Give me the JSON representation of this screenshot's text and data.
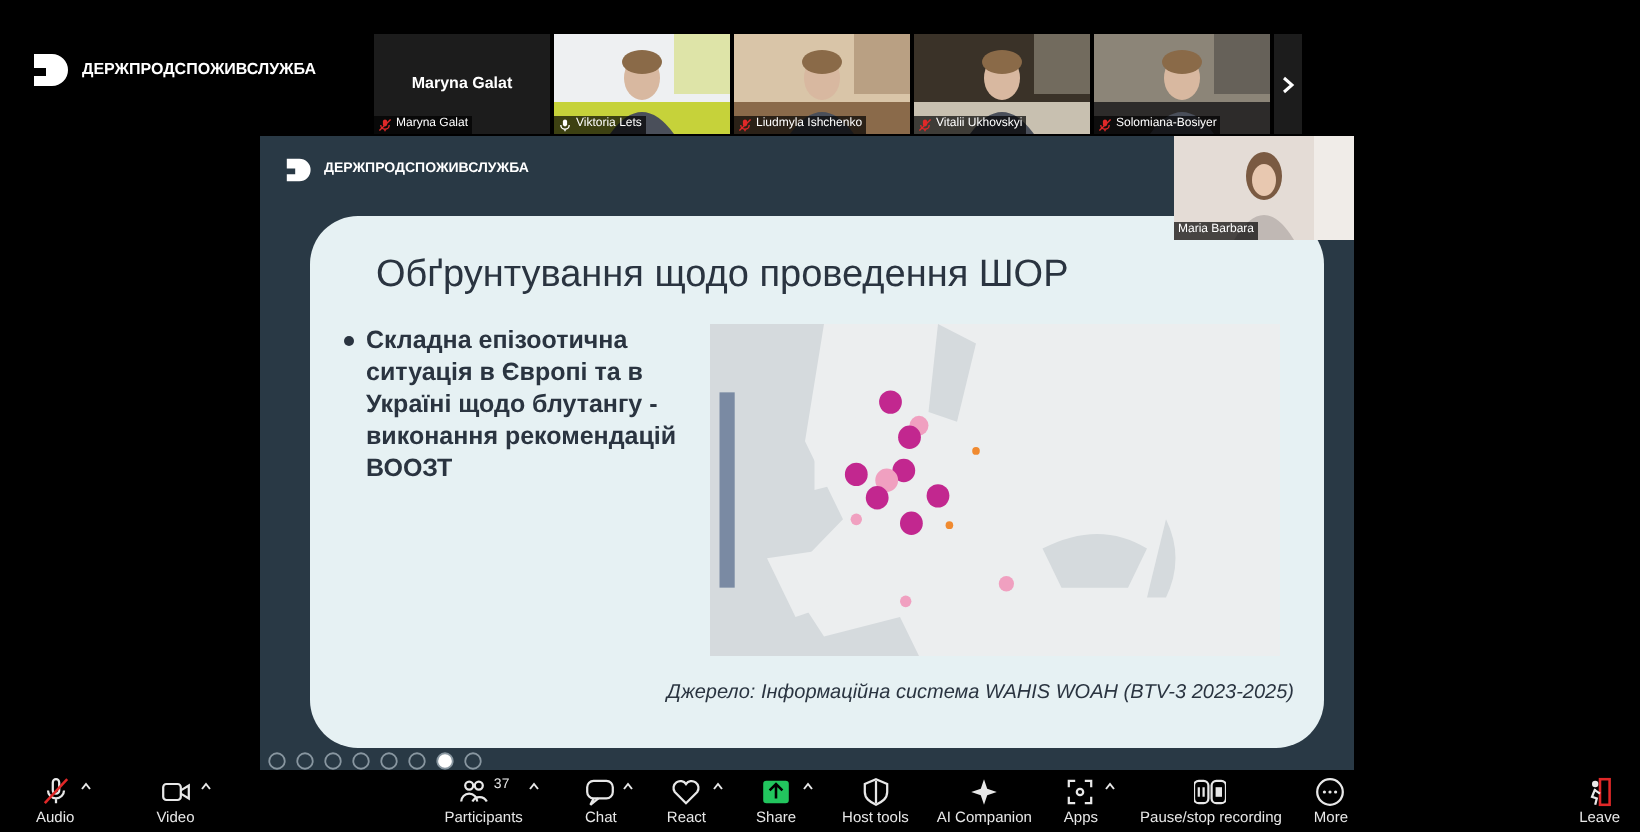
{
  "header": {
    "logo_text": "ДЕРЖПРОДСПОЖИВСЛУЖБА"
  },
  "participants_strip": [
    {
      "name": "Maryna Galat",
      "muted": true,
      "kind": "name_only",
      "title": "Maryna Galat"
    },
    {
      "name": "Viktoria Lets",
      "muted": false,
      "kind": "picture"
    },
    {
      "name": "Liudmyla Ishchenko",
      "muted": true,
      "kind": "picture"
    },
    {
      "name": "Vitalii Ukhovskyi",
      "muted": true,
      "kind": "picture"
    },
    {
      "name": "Solomiana-Bosiyer",
      "muted": true,
      "kind": "picture"
    }
  ],
  "presenter": {
    "name": "Maria Barbara"
  },
  "slide": {
    "logo_text": "ДЕРЖПРОДСПОЖИВСЛУЖБА",
    "title": "Обґрунтування щодо проведення ШОР",
    "bullet": "Складна епізоотична ситуація в Європі та в Україні щодо блутангу - виконання рекомендацій ВООЗТ",
    "source": "Джерело: Інформаційна система WAHIS WOAH (BTV-3 2023-2025)"
  },
  "toolbar": [
    {
      "label": "Audio",
      "kind": "mic",
      "caret": true,
      "muted": true
    },
    {
      "label": "Video",
      "kind": "video",
      "caret": true
    },
    {
      "label": "Participants",
      "kind": "people",
      "caret": true,
      "count": "37"
    },
    {
      "label": "Chat",
      "kind": "chat",
      "caret": true
    },
    {
      "label": "React",
      "kind": "heart",
      "caret": true
    },
    {
      "label": "Share",
      "kind": "share",
      "caret": true
    },
    {
      "label": "Host tools",
      "kind": "shield",
      "caret": false
    },
    {
      "label": "AI Companion",
      "kind": "sparkle",
      "caret": false
    },
    {
      "label": "Apps",
      "kind": "apps",
      "caret": true
    },
    {
      "label": "Pause/stop recording",
      "kind": "record",
      "caret": false
    },
    {
      "label": "More",
      "kind": "more",
      "caret": false
    },
    {
      "label": "Leave",
      "kind": "leave",
      "caret": false
    }
  ]
}
